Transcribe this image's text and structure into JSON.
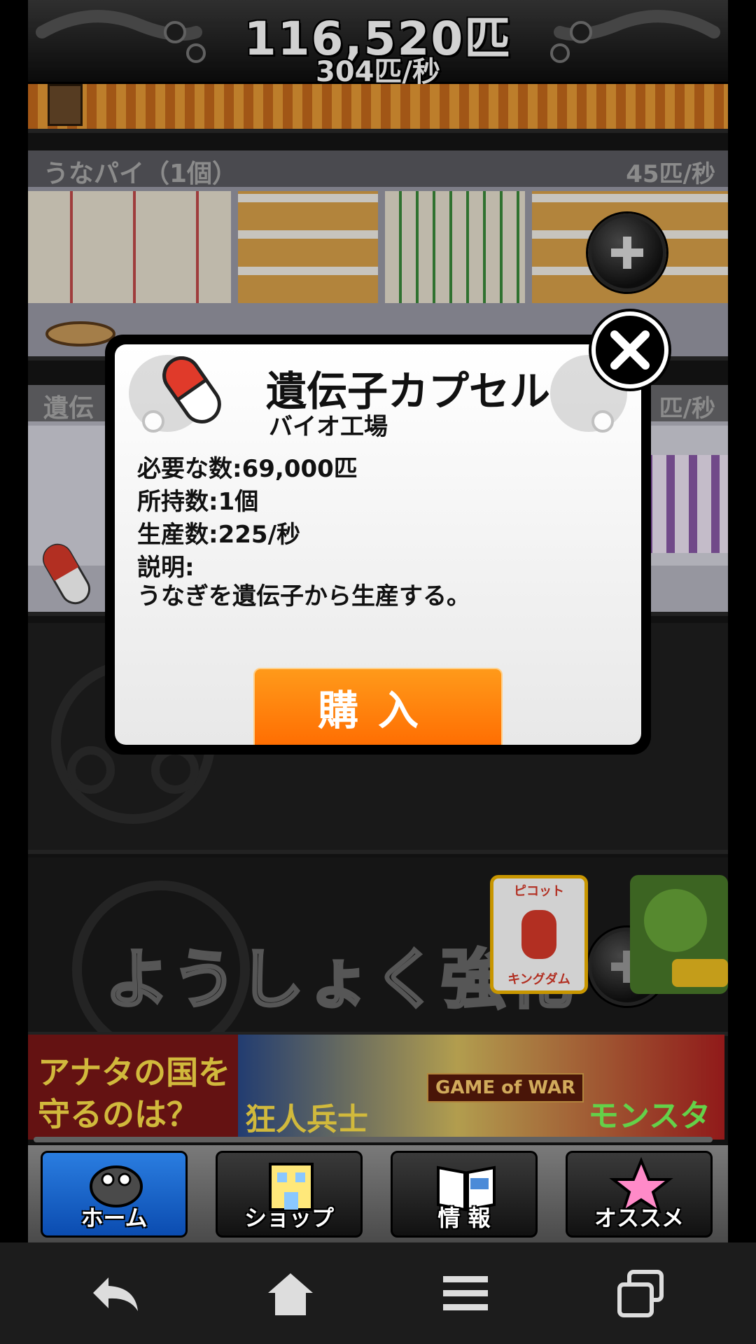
{
  "header": {
    "eel_count": "116,520匹",
    "eel_rate": "304匹/秒"
  },
  "rows": {
    "pie": {
      "name": "うなパイ（1個）",
      "rate": "45匹/秒"
    },
    "gene": {
      "name": "遺伝",
      "rate": "匹/秒"
    },
    "yoshoku": {
      "title": "ようしょく強化"
    }
  },
  "modal": {
    "title": "遺伝子カプセル",
    "subtitle": "バイオ工場",
    "required": "必要な数:69,000匹",
    "owned": "所持数:1個",
    "production": "生産数:225/秒",
    "desc_label": "説明:",
    "description": "うなぎを遺伝子から生産する。",
    "buy_label": "購入"
  },
  "ads": {
    "thumb1_top": "ピコット",
    "thumb1_bottom": "キングダム",
    "banner_left_line1": "アナタの国を",
    "banner_left_line2": "守るのは？",
    "banner_brand": "GAME of WAR",
    "banner_word1": "狂人兵士",
    "banner_word2": "モンスター"
  },
  "tabs": [
    {
      "label": "ホーム",
      "icon": "eel-icon",
      "active": true
    },
    {
      "label": "ショップ",
      "icon": "shop-building-icon",
      "active": false
    },
    {
      "label": "情 報",
      "icon": "newspaper-icon",
      "active": false
    },
    {
      "label": "オススメ",
      "icon": "star-icon",
      "active": false
    }
  ],
  "system_nav": [
    "back-icon",
    "home-icon",
    "menu-icon",
    "recent-apps-icon"
  ],
  "colors": {
    "buy_button": "#ff7a00",
    "active_tab": "#1a62c8",
    "modal_bg": "#f2f2f2"
  }
}
